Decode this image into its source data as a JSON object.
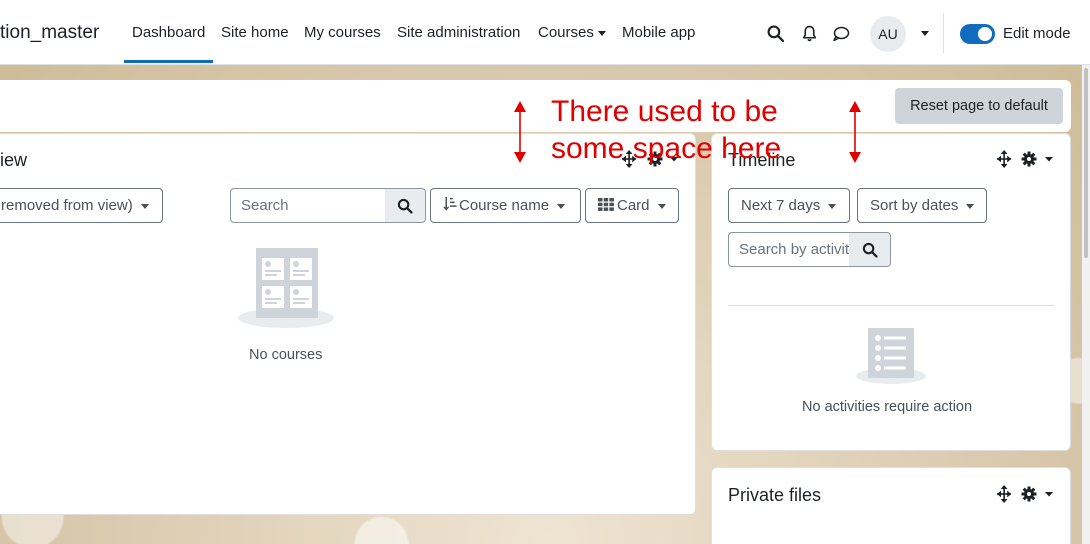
{
  "navbar": {
    "brand": "tion_master",
    "items": [
      {
        "label": "Dashboard",
        "active": true
      },
      {
        "label": "Site home"
      },
      {
        "label": "My courses"
      },
      {
        "label": "Site administration"
      },
      {
        "label": "Courses"
      },
      {
        "label": "Mobile app"
      }
    ],
    "avatar_initials": "AU",
    "edit_mode_label": "Edit mode",
    "edit_mode_on": true
  },
  "header": {
    "reset_button": "Reset page to default"
  },
  "course_overview": {
    "title": "iew",
    "filter_dropdown": "removed from view)",
    "search_placeholder": "Search",
    "sort_dropdown": "Course name",
    "view_dropdown": "Card",
    "empty_message": "No courses"
  },
  "timeline": {
    "title": "Timeline",
    "range_dropdown": "Next 7 days",
    "sort_dropdown": "Sort by dates",
    "search_placeholder": "Search by activity",
    "empty_message": "No activities require action"
  },
  "private_files": {
    "title": "Private files"
  },
  "annotation": {
    "line1": "There used to be",
    "line2": "some space here",
    "color": "#e00000"
  },
  "colors": {
    "accent": "#0f6cbf",
    "reset_button_bg": "#ced4da"
  }
}
